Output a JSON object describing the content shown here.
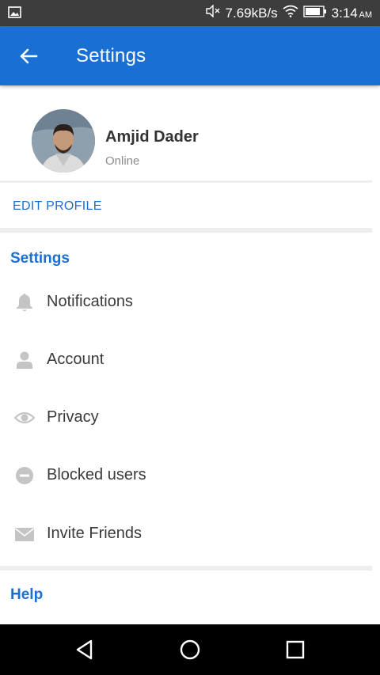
{
  "status_bar": {
    "speed": "7.69kB/s",
    "time": "3:14",
    "ampm": "AM",
    "icons": [
      "image-icon",
      "mute-icon",
      "wifi-icon",
      "battery-icon"
    ]
  },
  "app_bar": {
    "title": "Settings",
    "color": "#1a6fd3"
  },
  "profile": {
    "name": "Amjid Dader",
    "status": "Online",
    "edit_label": "EDIT PROFILE"
  },
  "settings_section": {
    "title": "Settings",
    "items": [
      {
        "label": "Notifications",
        "icon": "bell-icon"
      },
      {
        "label": "Account",
        "icon": "person-icon"
      },
      {
        "label": "Privacy",
        "icon": "eye-icon"
      },
      {
        "label": "Blocked users",
        "icon": "block-icon"
      },
      {
        "label": "Invite Friends",
        "icon": "mail-icon"
      }
    ]
  },
  "help_section": {
    "title": "Help"
  },
  "nav_bar": {
    "icons": [
      "back-triangle-icon",
      "home-circle-icon",
      "recents-square-icon"
    ]
  }
}
